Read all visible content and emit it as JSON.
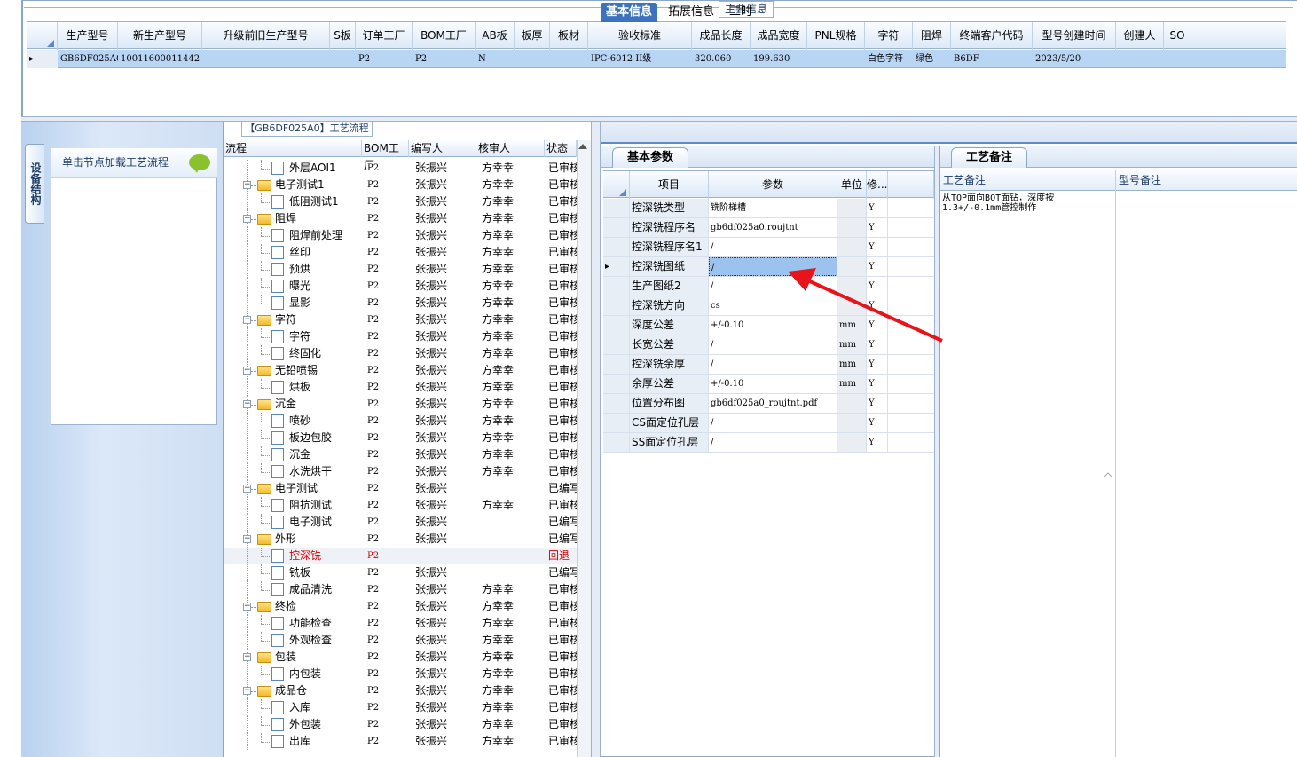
{
  "main_info": {
    "title": "主要信息",
    "columns": [
      "生产型号",
      "新生产型号",
      "升级前旧生产型号",
      "S板",
      "订单工厂",
      "BOM工厂",
      "AB板",
      "板厚",
      "板材",
      "验收标准",
      "成品长度",
      "成品宽度",
      "PNL规格",
      "字符",
      "阻焊",
      "终端客户代码",
      "型号创建时间",
      "创建人",
      "SO"
    ],
    "row": [
      "GB6DF025A0",
      "10011600011442",
      "",
      "",
      "P2",
      "P2",
      "N",
      "",
      "",
      "IPC-6012 II级",
      "320.060",
      "199.630",
      "",
      "白色字符",
      "绿色",
      "B6DF",
      "2023/5/20",
      "",
      ""
    ]
  },
  "left_panel": {
    "vertical_tab": "设备结构",
    "hint": "单击节点加载工艺流程"
  },
  "flow": {
    "title": "【GB6DF025A0】工艺流程",
    "columns": [
      "流程",
      "BOM工厂",
      "编写人",
      "核审人",
      "状态"
    ],
    "rows": [
      {
        "name": "外层AOI1",
        "level": 2,
        "type": "doc",
        "bom": "P2",
        "writer": "张振兴",
        "reviewer": "方幸幸",
        "status": "已审核"
      },
      {
        "name": "电子测试1",
        "level": 1,
        "type": "folder",
        "bom": "P2",
        "writer": "张振兴",
        "reviewer": "方幸幸",
        "status": "已审核"
      },
      {
        "name": "低阻测试1",
        "level": 2,
        "type": "doc",
        "bom": "P2",
        "writer": "张振兴",
        "reviewer": "方幸幸",
        "status": "已审核"
      },
      {
        "name": "阻焊",
        "level": 1,
        "type": "folder",
        "bom": "P2",
        "writer": "张振兴",
        "reviewer": "方幸幸",
        "status": "已审核"
      },
      {
        "name": "阻焊前处理",
        "level": 2,
        "type": "doc",
        "bom": "P2",
        "writer": "张振兴",
        "reviewer": "方幸幸",
        "status": "已审核"
      },
      {
        "name": "丝印",
        "level": 2,
        "type": "doc",
        "bom": "P2",
        "writer": "张振兴",
        "reviewer": "方幸幸",
        "status": "已审核"
      },
      {
        "name": "预烘",
        "level": 2,
        "type": "doc",
        "bom": "P2",
        "writer": "张振兴",
        "reviewer": "方幸幸",
        "status": "已审核"
      },
      {
        "name": "曝光",
        "level": 2,
        "type": "doc",
        "bom": "P2",
        "writer": "张振兴",
        "reviewer": "方幸幸",
        "status": "已审核"
      },
      {
        "name": "显影",
        "level": 2,
        "type": "doc",
        "bom": "P2",
        "writer": "张振兴",
        "reviewer": "方幸幸",
        "status": "已审核"
      },
      {
        "name": "字符",
        "level": 1,
        "type": "folder",
        "bom": "P2",
        "writer": "张振兴",
        "reviewer": "方幸幸",
        "status": "已审核"
      },
      {
        "name": "字符",
        "level": 2,
        "type": "doc",
        "bom": "P2",
        "writer": "张振兴",
        "reviewer": "方幸幸",
        "status": "已审核"
      },
      {
        "name": "终固化",
        "level": 2,
        "type": "doc",
        "bom": "P2",
        "writer": "张振兴",
        "reviewer": "方幸幸",
        "status": "已审核"
      },
      {
        "name": "无铅喷锡",
        "level": 1,
        "type": "folder",
        "bom": "P2",
        "writer": "张振兴",
        "reviewer": "方幸幸",
        "status": "已审核"
      },
      {
        "name": "烘板",
        "level": 2,
        "type": "doc",
        "bom": "P2",
        "writer": "张振兴",
        "reviewer": "方幸幸",
        "status": "已审核"
      },
      {
        "name": "沉金",
        "level": 1,
        "type": "folder",
        "bom": "P2",
        "writer": "张振兴",
        "reviewer": "方幸幸",
        "status": "已审核"
      },
      {
        "name": "喷砂",
        "level": 2,
        "type": "doc",
        "bom": "P2",
        "writer": "张振兴",
        "reviewer": "方幸幸",
        "status": "已审核"
      },
      {
        "name": "板边包胶",
        "level": 2,
        "type": "doc",
        "bom": "P2",
        "writer": "张振兴",
        "reviewer": "方幸幸",
        "status": "已审核"
      },
      {
        "name": "沉金",
        "level": 2,
        "type": "doc",
        "bom": "P2",
        "writer": "张振兴",
        "reviewer": "方幸幸",
        "status": "已审核"
      },
      {
        "name": "水洗烘干",
        "level": 2,
        "type": "doc",
        "bom": "P2",
        "writer": "张振兴",
        "reviewer": "方幸幸",
        "status": "已审核"
      },
      {
        "name": "电子测试",
        "level": 1,
        "type": "folder",
        "bom": "P2",
        "writer": "张振兴",
        "reviewer": "",
        "status": "已编写"
      },
      {
        "name": "阻抗测试",
        "level": 2,
        "type": "doc",
        "bom": "P2",
        "writer": "张振兴",
        "reviewer": "方幸幸",
        "status": "已审核"
      },
      {
        "name": "电子测试",
        "level": 2,
        "type": "doc",
        "bom": "P2",
        "writer": "张振兴",
        "reviewer": "",
        "status": "已编写"
      },
      {
        "name": "外形",
        "level": 1,
        "type": "folder",
        "bom": "P2",
        "writer": "张振兴",
        "reviewer": "",
        "status": "已编写"
      },
      {
        "name": "控深铣",
        "level": 2,
        "type": "doc",
        "bom": "P2",
        "writer": "",
        "reviewer": "",
        "status": "回退",
        "highlight": true
      },
      {
        "name": "铣板",
        "level": 2,
        "type": "doc",
        "bom": "P2",
        "writer": "张振兴",
        "reviewer": "",
        "status": "已编写"
      },
      {
        "name": "成品清洗",
        "level": 2,
        "type": "doc",
        "bom": "P2",
        "writer": "张振兴",
        "reviewer": "方幸幸",
        "status": "已审核"
      },
      {
        "name": "终检",
        "level": 1,
        "type": "folder",
        "bom": "P2",
        "writer": "张振兴",
        "reviewer": "方幸幸",
        "status": "已审核"
      },
      {
        "name": "功能检查",
        "level": 2,
        "type": "doc",
        "bom": "P2",
        "writer": "张振兴",
        "reviewer": "方幸幸",
        "status": "已审核"
      },
      {
        "name": "外观检查",
        "level": 2,
        "type": "doc",
        "bom": "P2",
        "writer": "张振兴",
        "reviewer": "方幸幸",
        "status": "已审核"
      },
      {
        "name": "包装",
        "level": 1,
        "type": "folder",
        "bom": "P2",
        "writer": "张振兴",
        "reviewer": "方幸幸",
        "status": "已审核"
      },
      {
        "name": "内包装",
        "level": 2,
        "type": "doc",
        "bom": "P2",
        "writer": "张振兴",
        "reviewer": "方幸幸",
        "status": "已审核"
      },
      {
        "name": "成品仓",
        "level": 1,
        "type": "folder",
        "bom": "P2",
        "writer": "张振兴",
        "reviewer": "方幸幸",
        "status": "已审核"
      },
      {
        "name": "入库",
        "level": 2,
        "type": "doc",
        "bom": "P2",
        "writer": "张振兴",
        "reviewer": "方幸幸",
        "status": "已审核"
      },
      {
        "name": "外包装",
        "level": 2,
        "type": "doc",
        "bom": "P2",
        "writer": "张振兴",
        "reviewer": "方幸幸",
        "status": "已审核"
      },
      {
        "name": "出库",
        "level": 2,
        "type": "doc",
        "bom": "P2",
        "writer": "张振兴",
        "reviewer": "方幸幸",
        "status": "已审核"
      }
    ]
  },
  "tabs": [
    "基本信息",
    "拓展信息",
    "工时"
  ],
  "basic": {
    "tab": "基本参数",
    "columns": [
      "项目",
      "参数",
      "单位",
      "修..."
    ],
    "rows": [
      {
        "item": "控深铣类型",
        "param": "铣阶梯槽",
        "unit": "",
        "mod": "Y"
      },
      {
        "item": "控深铣程序名",
        "param": "gb6df025a0.roujtnt",
        "unit": "",
        "mod": "Y"
      },
      {
        "item": "控深铣程序名1",
        "param": "/",
        "unit": "",
        "mod": "Y"
      },
      {
        "item": "控深铣图纸",
        "param": "/",
        "unit": "",
        "mod": "Y",
        "selected": true
      },
      {
        "item": "生产图纸2",
        "param": "/",
        "unit": "",
        "mod": "Y"
      },
      {
        "item": "控深铣方向",
        "param": "cs",
        "unit": "",
        "mod": "Y"
      },
      {
        "item": "深度公差",
        "param": "+/-0.10",
        "unit": "mm",
        "mod": "Y"
      },
      {
        "item": "长宽公差",
        "param": "/",
        "unit": "mm",
        "mod": "Y"
      },
      {
        "item": "控深铣余厚",
        "param": "/",
        "unit": "mm",
        "mod": "Y"
      },
      {
        "item": "余厚公差",
        "param": "+/-0.10",
        "unit": "mm",
        "mod": "Y"
      },
      {
        "item": "位置分布图",
        "param": "gb6df025a0_roujtnt.pdf",
        "unit": "",
        "mod": "Y"
      },
      {
        "item": "CS面定位孔层",
        "param": "/",
        "unit": "",
        "mod": "Y"
      },
      {
        "item": "SS面定位孔层",
        "param": "/",
        "unit": "",
        "mod": "Y"
      }
    ]
  },
  "remark": {
    "tab": "工艺备注",
    "col1": "工艺备注",
    "col2": "型号备注",
    "text": "从TOP面向BOT面钻，深度按\n1.3+/-0.1mm管控制作"
  },
  "colors": {
    "accent": "#3d73bd",
    "highlight_row": "#b9d5f4",
    "arrow": "#e8141b",
    "status_back": "#d40000"
  }
}
